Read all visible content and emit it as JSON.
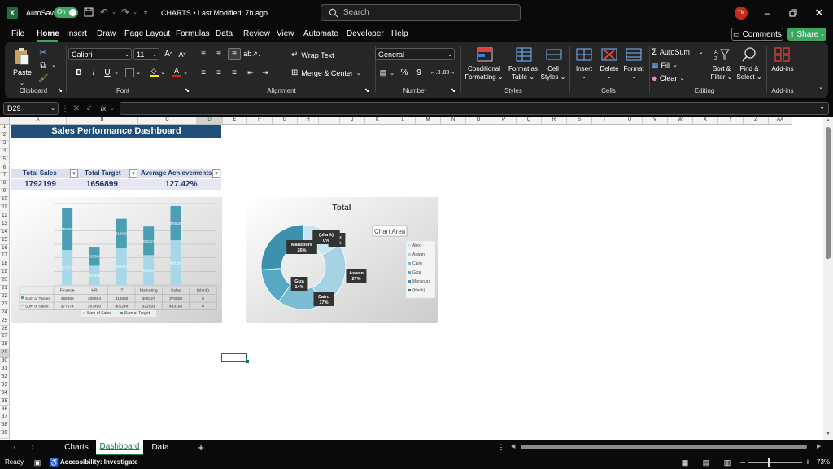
{
  "titlebar": {
    "autosave_label": "AutoSave",
    "autosave_state": "On",
    "file_title": "CHARTS • Last Modified: 7h ago",
    "search_placeholder": "Search",
    "avatar_initials": "YM"
  },
  "menu": {
    "items": [
      "File",
      "Home",
      "Insert",
      "Draw",
      "Page Layout",
      "Formulas",
      "Data",
      "Review",
      "View",
      "Automate",
      "Developer",
      "Help"
    ],
    "active": "Home",
    "comments_label": "Comments",
    "share_label": "Share"
  },
  "ribbon": {
    "clipboard": {
      "paste": "Paste",
      "group": "Clipboard"
    },
    "font": {
      "family": "Calibri",
      "size": "11",
      "group": "Font"
    },
    "alignment": {
      "wrap_text": "Wrap Text",
      "merge_center": "Merge & Center",
      "group": "Alignment"
    },
    "number": {
      "format": "General",
      "group": "Number"
    },
    "styles": {
      "conditional": "Conditional",
      "formatting": "Formatting",
      "format_as": "Format as",
      "table": "Table",
      "cell": "Cell",
      "styles_label": "Styles",
      "group": "Styles"
    },
    "cells": {
      "insert": "Insert",
      "delete": "Delete",
      "format": "Format",
      "group": "Cells"
    },
    "editing": {
      "autosum": "AutoSum",
      "fill": "Fill",
      "clear": "Clear",
      "sort": "Sort &",
      "filter": "Filter",
      "find": "Find &",
      "select": "Select",
      "group": "Editing"
    },
    "addins": {
      "label": "Add-ins",
      "group": "Add-ins"
    }
  },
  "formula_bar": {
    "name_box": "D29",
    "fx": "fx",
    "formula": ""
  },
  "columns": [
    "A",
    "B",
    "C",
    "D",
    "E",
    "F",
    "G",
    "H",
    "I",
    "J",
    "K",
    "L",
    "M",
    "N",
    "O",
    "P",
    "Q",
    "R",
    "S",
    "T",
    "U",
    "V",
    "W",
    "X",
    "Y",
    "Z",
    "AA"
  ],
  "rows": [
    "1",
    "2",
    "3",
    "4",
    "5",
    "6",
    "7",
    "8",
    "9",
    "10",
    "11",
    "12",
    "13",
    "14",
    "15",
    "16",
    "17",
    "18",
    "19",
    "20",
    "21",
    "22",
    "23",
    "24",
    "25",
    "26",
    "27",
    "28",
    "29",
    "30",
    "31",
    "32",
    "33",
    "34",
    "35",
    "36",
    "37",
    "38",
    "39"
  ],
  "dashboard": {
    "title": "Sales Performance Dashboard",
    "kpi_headers": [
      "Total Sales",
      "Total Target",
      "Average Achievements"
    ],
    "kpi_values": [
      "1792199",
      "1656899",
      "127.42%"
    ]
  },
  "chart_data": [
    {
      "type": "bar",
      "stacked": true,
      "categories": [
        "Finance",
        "HR",
        "IT",
        "Marketing",
        "Sales",
        "(blank)"
      ],
      "series": [
        {
          "name": "Sum of Target",
          "values": [
            458388,
            205584,
            314980,
            309327,
            370820,
            0
          ]
        },
        {
          "name": "Sum of Sales",
          "values": [
            377674,
            207496,
            401244,
            322591,
            483194,
            0
          ]
        }
      ],
      "bar_labels": {
        "Sum of Target": [
          "458388",
          "205584",
          "314980",
          "309327",
          "370820",
          ""
        ],
        "Sum of Sales": [
          "377674",
          "207496",
          "401244",
          "322591",
          "483194",
          ""
        ]
      },
      "table_rows": [
        {
          "label": "Sum of Target",
          "cells": [
            "458388",
            "205584",
            "314980",
            "309327",
            "370820",
            "0"
          ]
        },
        {
          "label": "Sum of Sales",
          "cells": [
            "377674",
            "207496",
            "401244",
            "322591",
            "483194",
            "0"
          ]
        }
      ],
      "legend": [
        "Sum of Sales",
        "Sum of Target"
      ],
      "colors": {
        "Sum of Target": "#4a9fb5",
        "Sum of Sales": "#a8d8e8"
      }
    },
    {
      "type": "pie",
      "donut": true,
      "title": "Total",
      "tooltip": "Chart Area",
      "slices": [
        {
          "name": "Alex",
          "label": "Alex",
          "percent": "16%",
          "value": 16,
          "color": "#c6e5ef"
        },
        {
          "name": "Aswan",
          "label": "Aswan",
          "percent": "27%",
          "value": 27,
          "color": "#a6d3e3"
        },
        {
          "name": "Cairo",
          "label": "Cairo",
          "percent": "17%",
          "value": 17,
          "color": "#7dbdd3"
        },
        {
          "name": "Giza",
          "label": "Giza",
          "percent": "14%",
          "value": 14,
          "color": "#58a8c4"
        },
        {
          "name": "Mansoura",
          "label": "Mansoura",
          "percent": "26%",
          "value": 26,
          "color": "#3d90ae"
        },
        {
          "name": "(blank)",
          "label": "(blank)",
          "percent": "0%",
          "value": 0,
          "color": "#2b7893"
        }
      ],
      "legend_position": "right"
    }
  ],
  "sheet_tabs": [
    "Charts",
    "Dashboard",
    "Data"
  ],
  "active_sheet": "Dashboard",
  "status": {
    "ready": "Ready",
    "accessibility": "Accessibility: Investigate",
    "zoom": "73%"
  }
}
